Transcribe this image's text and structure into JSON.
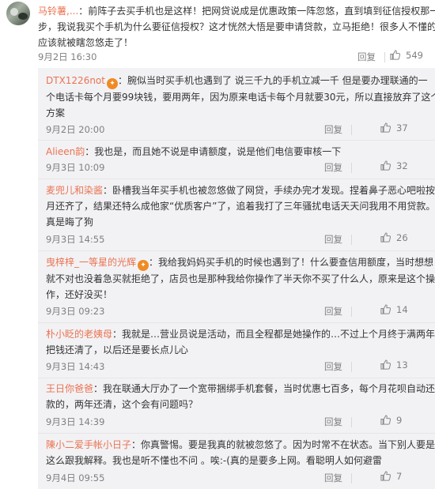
{
  "top_comment": {
    "user": "马铃薯,...",
    "lines": [
      "：前阵子去买手机也是这样！把网贷说成是优惠政策一阵忽悠，直到填到征信授权那一",
      "步，我说我买个手机为什么要征信授权？这才恍然大悟是要申请贷款，立马拒绝！很多人不懂的话",
      "应该就被瞎忽悠走了！"
    ],
    "time": "9月2日 16:30",
    "reply_label": "回复",
    "likes": "549"
  },
  "replies": [
    {
      "user": "DTX1226not",
      "badge": "🔥",
      "lines": [
        "：腕似当时买手机也遇到了   说三千九的手机立减一千   但是要办理联通的一",
        "个电话卡每个月要99块钱，要用两年，因为原来电话卡每个月就要30元，所以直接放弃了这个",
        "方案"
      ],
      "time": "9月2日 20:00",
      "reply_label": "回复",
      "likes": "37"
    },
    {
      "user": "Alieen韵",
      "badge": "",
      "lines": [
        "：我也是，而且她不说是申请额度，说是他们电信要审核一下"
      ],
      "time": "9月3日 10:09",
      "reply_label": "回复",
      "likes": "32"
    },
    {
      "user": "麦兜儿和染酱",
      "badge": "",
      "lines": [
        "：卧槽我当年买手机也被忽悠做了网贷，手续办完才发现。捏着鼻子恶心吧啦按",
        "月还齐了，结果还特么成他家“优质客户”了，追着我打了三年骚扰电话天天问我用不用贷款。",
        "真是晦了狗"
      ],
      "time": "9月3日 14:55",
      "reply_label": "回复",
      "likes": "26"
    },
    {
      "user": "曳梓梓_一等星的光辉",
      "badge": "🔥",
      "lines": [
        "：我给我妈妈买手机的时候也遇到了！什么要查信用额度，当时想想",
        "就不对也没着急买就拒绝了，店员也是那种我给你操作了半天你不买了什么人，原来是这个操",
        "作，还好没买！"
      ],
      "time": "9月3日 09:23",
      "reply_label": "回复",
      "likes": "14"
    },
    {
      "user": "朴小眨的老姨母",
      "badge": "",
      "lines": [
        "：我就是…营业员说是活动，而且全程都是她操作的…不过上个月终于满两年",
        "把钱还清了，以后还是要长点儿心"
      ],
      "time": "9月3日 14:43",
      "reply_label": "回复",
      "likes": "13"
    },
    {
      "user": "王日你爸爸",
      "badge": "",
      "lines": [
        "：我在联通大厅办了一个宽带捆绑手机套餐，当时优惠七百多，每个月花呗自动还",
        "款的，两年还清，这个会有问题吗？"
      ],
      "time": "9月3日 14:39",
      "reply_label": "回复",
      "likes": "9"
    },
    {
      "user": "陳小二爱手帐小日子",
      "badge": "",
      "lines": [
        "：你真警惕。要是我真的就被忽悠了。因为时常不在状态。当下别人要是",
        "这么跟我解释。我也是听不懂也不问 。唉:-(真的是要多上网。看聪明人如何避雷"
      ],
      "time": "9月4日 09:55",
      "reply_label": "回复",
      "likes": "7"
    }
  ]
}
